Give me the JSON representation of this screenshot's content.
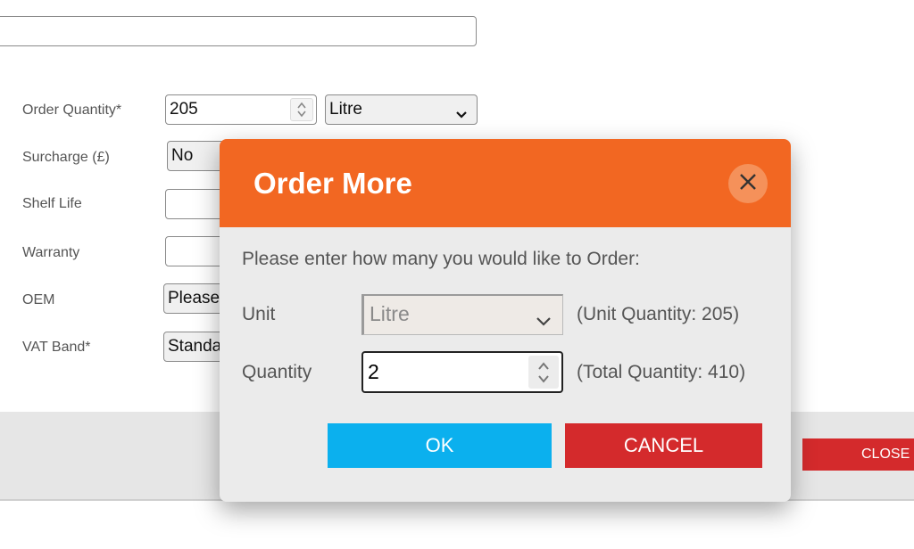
{
  "form": {
    "top_input_value": "",
    "order_quantity_label": "Order Quantity*",
    "order_quantity_value": "205",
    "unit_value": "Litre",
    "surcharge_label": "Surcharge (£)",
    "surcharge_value": "No",
    "shelf_life_label": "Shelf Life",
    "shelf_life_value": "",
    "warranty_label": "Warranty",
    "warranty_value": "",
    "oem_label": "OEM",
    "oem_value": "Please",
    "vat_band_label": "VAT Band*",
    "vat_band_value": "Standa"
  },
  "footer": {
    "close_label": "CLOSE"
  },
  "dialog": {
    "title": "Order More",
    "prompt": "Please enter how many you would like to Order:",
    "unit_label": "Unit",
    "unit_value": "Litre",
    "unit_info": "(Unit Quantity: 205)",
    "quantity_label": "Quantity",
    "quantity_value": "2",
    "total_info": "(Total Quantity: 410)",
    "ok_label": "OK",
    "cancel_label": "CANCEL"
  },
  "icons": {
    "dialog_close": "close-icon",
    "spinner": "spinner-arrows-icon",
    "dropdown": "chevron-down-icon"
  },
  "colors": {
    "header": "#f26722",
    "ok": "#0bb0ee",
    "cancel": "#d42a2c"
  }
}
